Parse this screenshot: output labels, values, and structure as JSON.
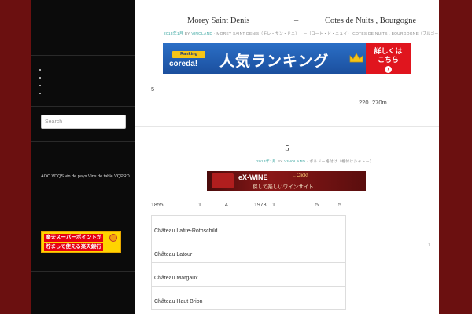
{
  "sidebar": {
    "tagline": "...",
    "menu_dot_count": 4,
    "search_placeholder": "Search",
    "categories_text": "AOC VDQS vin de pays Vins de table VQPRD",
    "rakuten_banner": {
      "line1": "楽天スーパーポイントが",
      "line2": "貯まって使える楽天銀行"
    }
  },
  "post1": {
    "title_left": "Morey Saint Denis",
    "title_dash": "–",
    "title_right": "Cotes de Nuits , Bourgogne",
    "meta": {
      "date": "2013年1月",
      "by": "BY",
      "author": "VINOLAND",
      "sep": "·",
      "category1": "MOREY SAINT DENIS（モレ・サン・ドニ）",
      "category2": "ー（コート・ド・ニュイ） COTES DE NUITS , BOURGOGNE（ブルゴーニュ）"
    },
    "banner": {
      "ranking_label": "Ranking",
      "logo": "coreda!",
      "headline": "人気ランキング",
      "cta_line1": "詳しくは",
      "cta_line2": "こちら",
      "cta_arrow": "›"
    },
    "body_num": "5",
    "body_right_a": "220",
    "body_right_b": "270m"
  },
  "post2": {
    "title": "5",
    "meta": {
      "date": "2013年1月",
      "by": "BY",
      "author": "VINOLAND",
      "sep": "·",
      "category1": "ボルドー格付け（格付けシャトー）"
    },
    "banner": {
      "logo": "eX-WINE",
      "click": "←Click!",
      "subtitle": "探して楽しいワインサイト"
    },
    "table_header": [
      "1855",
      "1",
      "4",
      "1973",
      "1",
      "5",
      "5"
    ],
    "rows": [
      "Château Lafite-Rothschild",
      "Château Latour",
      "Château Margaux",
      "Château Haut Brion"
    ],
    "side_num": "1"
  },
  "colors": {
    "background": "#6b1010",
    "sidebar": "#0b0b0b",
    "accent": "#3aa6a0"
  }
}
